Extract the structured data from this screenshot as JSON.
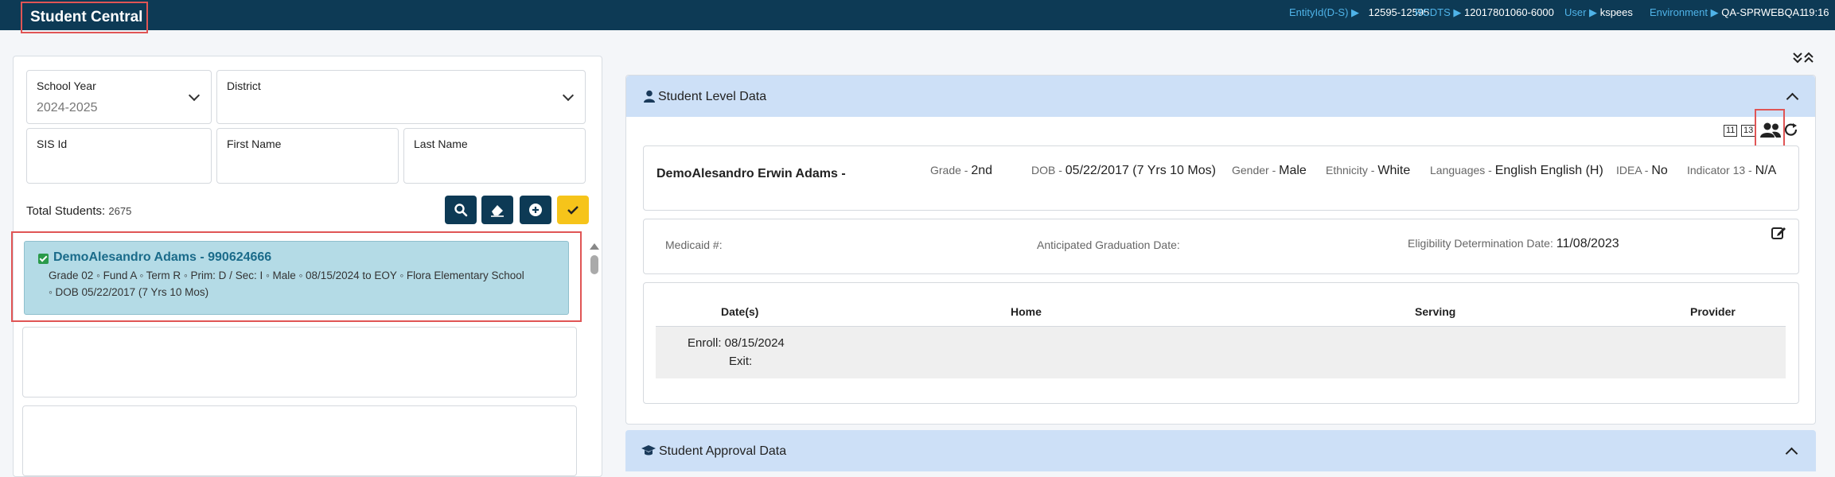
{
  "app": {
    "title": "Student Central"
  },
  "env_bar": {
    "entity_label": "EntityId(D-S) ▶",
    "entity_value": "12595-12595",
    "rcdts_label": "RCDTS ▶",
    "rcdts_value": "12017801060-6000",
    "user_label": "User ▶",
    "user_value": "kspees",
    "environment_label": "Environment ▶",
    "environment_value": "QA-SPRWEBQA1",
    "time": "19:16"
  },
  "filters": {
    "school_year_label": "School Year",
    "school_year_value": "2024-2025",
    "district_label": "District",
    "district_value": "",
    "sis_id_label": "SIS Id",
    "first_name_label": "First Name",
    "last_name_label": "Last Name"
  },
  "total": {
    "label": "Total Students:",
    "count": "2675"
  },
  "student": {
    "name": "DemoAlesandro Adams - 990624666",
    "line1": "Grade 02 ◦ Fund A ◦ Term R ◦ Prim: D / Sec: I ◦ Male ◦ 08/15/2024 to EOY ◦ Flora Elementary School",
    "line2": "◦ DOB 05/22/2017 (7 Yrs 10 Mos)"
  },
  "student_level": {
    "title": "Student Level Data",
    "icon_11": "11",
    "icon_13": "13",
    "full_name": "DemoAlesandro Erwin Adams -",
    "grade_label": "Grade -",
    "grade_value": "2nd",
    "dob_label": "DOB -",
    "dob_value": "05/22/2017 (7 Yrs 10 Mos)",
    "gender_label": "Gender -",
    "gender_value": "Male",
    "ethnicity_label": "Ethnicity -",
    "ethnicity_value": "White",
    "languages_label": "Languages -",
    "languages_value": "English English (H)",
    "idea_label": "IDEA -",
    "idea_value": "No",
    "indicator_label": "Indicator 13 -",
    "indicator_value": "N/A",
    "medicaid_label": "Medicaid #:",
    "grad_label": "Anticipated Graduation Date:",
    "eligibility_label": "Eligibility Determination Date:",
    "eligibility_value": "11/08/2023",
    "table": {
      "headers": [
        "Date(s)",
        "Home",
        "Serving",
        "Provider"
      ],
      "enroll": "Enroll: 08/15/2024",
      "exit": "Exit:"
    }
  },
  "approval": {
    "title": "Student Approval Data"
  }
}
